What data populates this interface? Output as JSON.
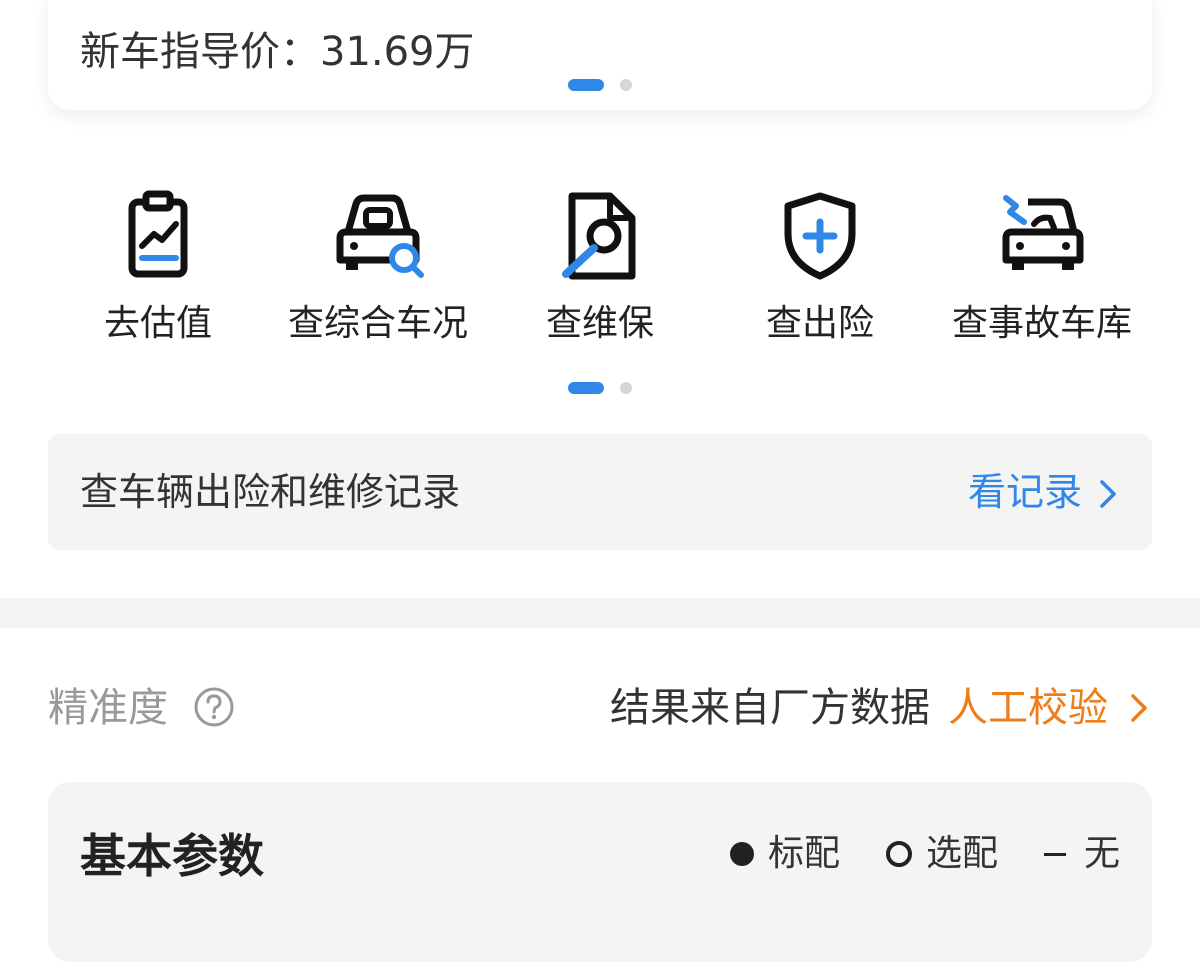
{
  "price_card": {
    "guide_price": "新车指导价：31.69万"
  },
  "functions": [
    {
      "label": "去估值",
      "icon": "valuation-clipboard-chart-icon"
    },
    {
      "label": "查综合车况",
      "icon": "car-search-icon"
    },
    {
      "label": "查维保",
      "icon": "maintenance-wrench-document-icon"
    },
    {
      "label": "查出险",
      "icon": "insurance-shield-plus-icon"
    },
    {
      "label": "查事故车库",
      "icon": "accident-car-icon"
    }
  ],
  "records_banner": {
    "text": "查车辆出险和维修记录",
    "action": "看记录",
    "chevron_icon": "chevron-right-icon"
  },
  "accuracy": {
    "label": "精准度",
    "help_icon": "question-circle-icon",
    "source": "结果来自厂方数据",
    "verify_action": "人工校验"
  },
  "basic_params": {
    "title": "基本参数",
    "legend": {
      "standard": "标配",
      "optional": "选配",
      "none": "无"
    }
  },
  "colors": {
    "accent_blue": "#2f87e8",
    "accent_orange": "#f07d1a",
    "text_dark": "#222222",
    "text_muted": "#999999"
  },
  "pagers": {
    "top": {
      "active_page": 1,
      "total_pages": 2
    },
    "functions": {
      "active_page": 1,
      "total_pages": 2
    }
  }
}
